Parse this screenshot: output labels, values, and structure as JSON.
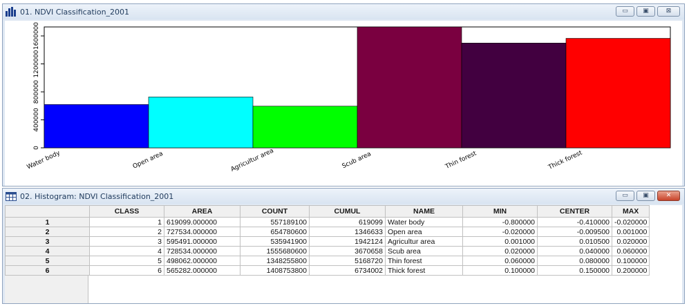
{
  "chart_window": {
    "title": "01. NDVI Classification_2001",
    "icon": "bar-chart-icon",
    "buttons": {
      "minimize": "▭",
      "maximize": "▣",
      "close": "⊠"
    }
  },
  "chart_data": {
    "type": "bar",
    "categories": [
      "Water body",
      "Open area",
      "Agricultur area",
      "Scub area",
      "Thin forest",
      "Thick forest"
    ],
    "values": [
      619099,
      727534,
      595491,
      1728534,
      1498062,
      1565282
    ],
    "colors": [
      "#0000ff",
      "#00ffff",
      "#00ff00",
      "#7a0040",
      "#420040",
      "#ff0000"
    ],
    "ylim": [
      0,
      1728534
    ],
    "yticks": [
      0,
      400000,
      800000,
      1200000,
      1600000
    ],
    "ytick_labels": [
      "0",
      "400000",
      "800000",
      "1200000",
      "1600000"
    ]
  },
  "table_window": {
    "title": "02. Histogram: NDVI Classification_2001",
    "icon": "table-icon",
    "buttons": {
      "minimize": "▭",
      "maximize": "▣",
      "close": "✕"
    }
  },
  "table": {
    "columns": [
      "CLASS",
      "AREA",
      "COUNT",
      "CUMUL",
      "NAME",
      "MIN",
      "CENTER",
      "MAX"
    ],
    "rows": [
      {
        "row": "1",
        "cells": [
          "1",
          "619099.000000",
          "557189100",
          "619099",
          "Water body",
          "-0.800000",
          "-0.410000",
          "-0.020000"
        ]
      },
      {
        "row": "2",
        "cells": [
          "2",
          "727534.000000",
          "654780600",
          "1346633",
          "Open area",
          "-0.020000",
          "-0.009500",
          "0.001000"
        ]
      },
      {
        "row": "3",
        "cells": [
          "3",
          "595491.000000",
          "535941900",
          "1942124",
          "Agricultur area",
          "0.001000",
          "0.010500",
          "0.020000"
        ]
      },
      {
        "row": "4",
        "cells": [
          "4",
          "728534.000000",
          "1555680600",
          "3670658",
          "Scub area",
          "0.020000",
          "0.040000",
          "0.060000"
        ]
      },
      {
        "row": "5",
        "cells": [
          "5",
          "498062.000000",
          "1348255800",
          "5168720",
          "Thin forest",
          "0.060000",
          "0.080000",
          "0.100000"
        ]
      },
      {
        "row": "6",
        "cells": [
          "6",
          "565282.000000",
          "1408753800",
          "6734002",
          "Thick forest",
          "0.100000",
          "0.150000",
          "0.200000"
        ]
      }
    ]
  }
}
